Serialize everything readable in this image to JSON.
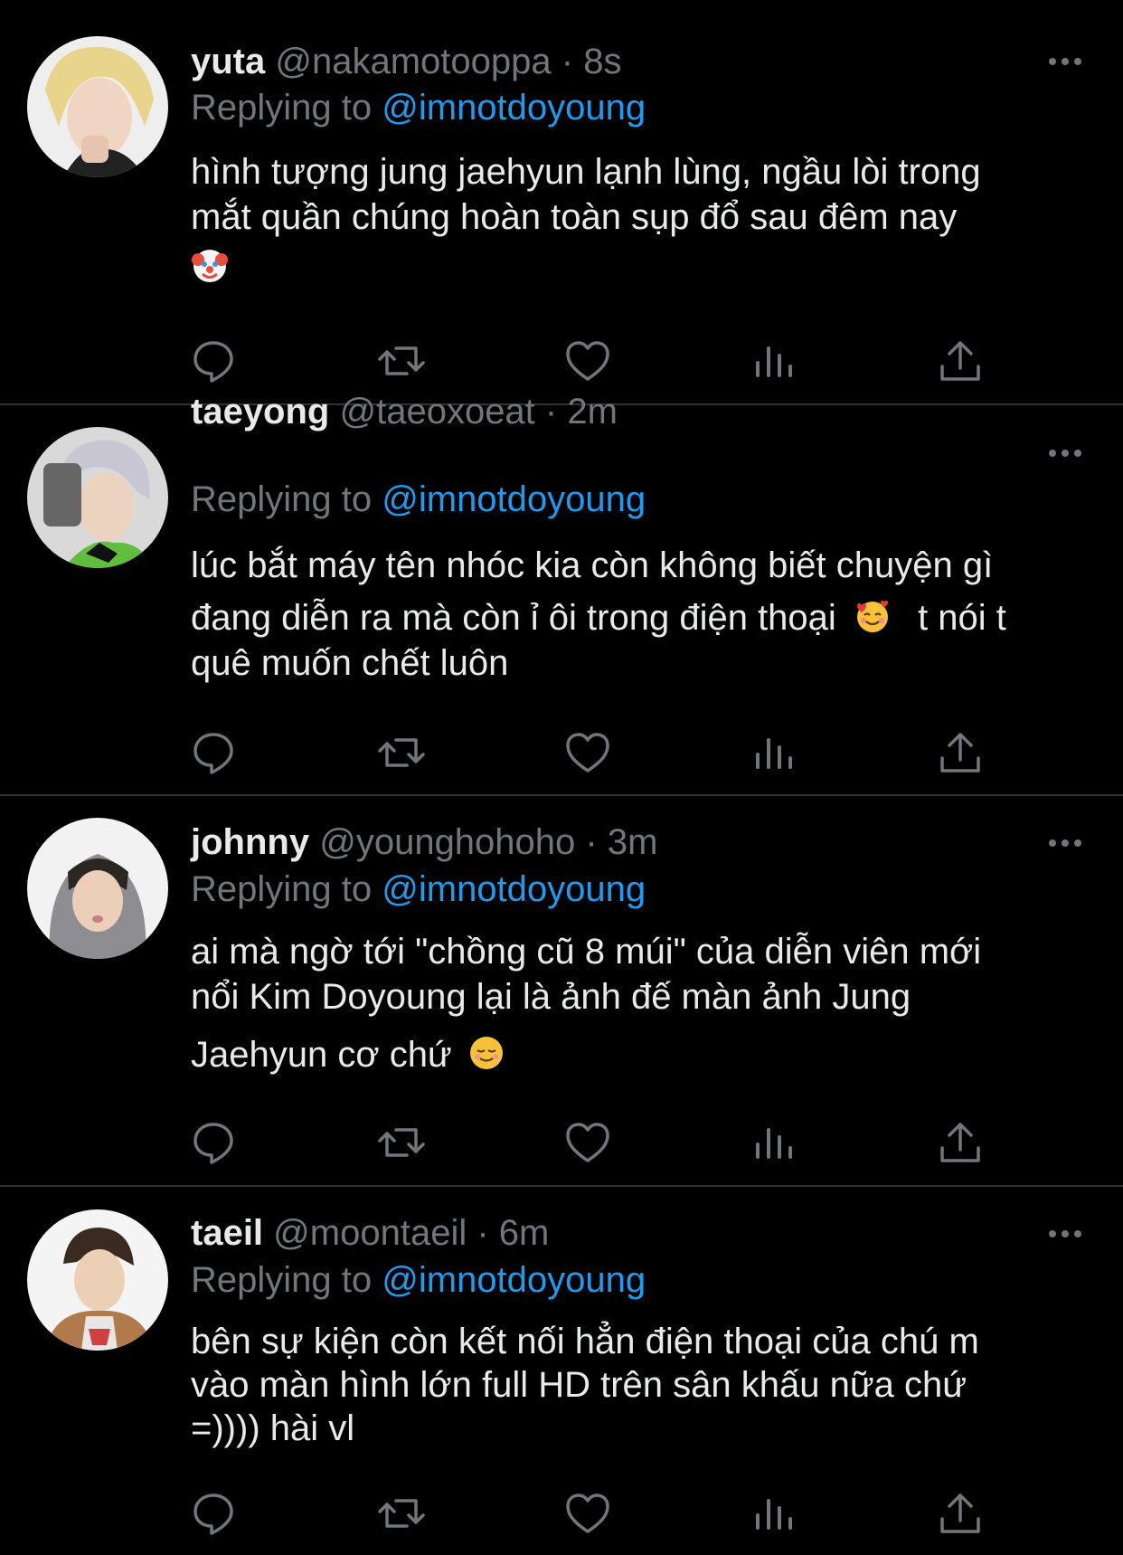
{
  "colors": {
    "background": "#000000",
    "primary_text": "#e7e9ea",
    "secondary_text": "#71767b",
    "accent": "#1d9bf0",
    "divider": "#2f3336"
  },
  "icons": {
    "reply": "reply-icon",
    "retweet": "retweet-icon",
    "like": "like-icon",
    "analytics": "analytics-icon",
    "share": "share-icon",
    "more": "more-icon"
  },
  "tweets": [
    {
      "name": "yuta",
      "handle": "@nakamotooppa",
      "separator": "·",
      "time": "8s",
      "replying_prefix": "Replying to",
      "replying_to": "@imnotdoyoung",
      "lines": [
        "hình tượng jung jaehyun lạnh lùng, ngầu lòi trong",
        "mắt quần chúng hoàn toàn sụp đổ sau đêm nay"
      ],
      "emoji": "clown-face"
    },
    {
      "name": "taeyong",
      "handle": "@taeoxoeat",
      "separator": "·",
      "time": "2m",
      "replying_prefix": "Replying to",
      "replying_to": "@imnotdoyoung",
      "lines": [
        "lúc bắt máy tên nhóc kia còn không biết chuyện gì",
        "đang diễn ra mà còn ỉ ôi trong điện thoại",
        "t nói t",
        "quê muốn chết luôn"
      ],
      "emoji": "smiling-face-with-hearts"
    },
    {
      "name": "johnny",
      "handle": "@younghohoho",
      "separator": "·",
      "time": "3m",
      "replying_prefix": "Replying to",
      "replying_to": "@imnotdoyoung",
      "lines": [
        "ai mà ngờ tới \"chồng cũ 8 múi\" của diễn viên mới",
        "nổi Kim Doyoung lại là ảnh đế màn ảnh Jung",
        "Jaehyun cơ chứ"
      ],
      "emoji": "smiling-face"
    },
    {
      "name": "taeil",
      "handle": "@moontaeil",
      "separator": "·",
      "time": "6m",
      "replying_prefix": "Replying to",
      "replying_to": "@imnotdoyoung",
      "lines": [
        "bên sự kiện còn kết nối hẳn điện thoại của chú m",
        "vào màn hình lớn full HD trên sân khấu nữa chứ",
        "=)))) hài vl"
      ]
    }
  ]
}
